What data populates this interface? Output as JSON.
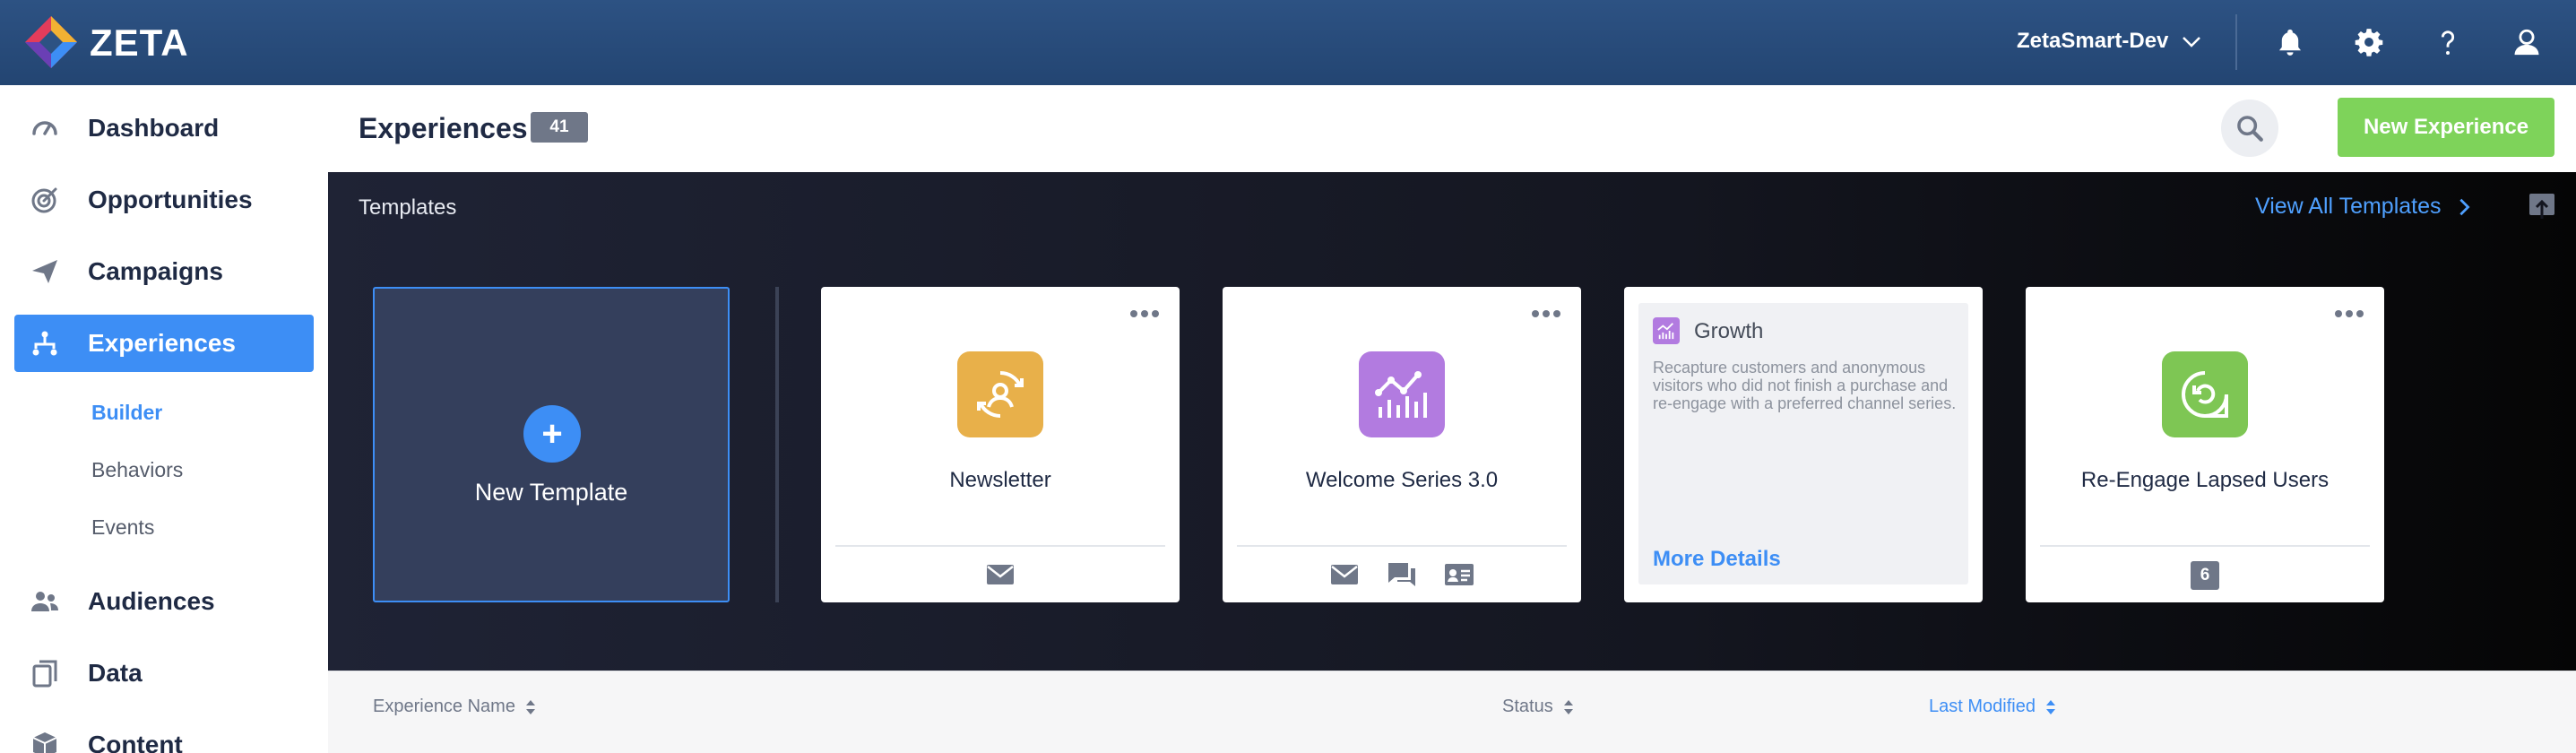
{
  "app": {
    "brand": "ZETA"
  },
  "topbar": {
    "account_name": "ZetaSmart-Dev",
    "icons": [
      "bell-icon",
      "gear-icon",
      "help-icon",
      "user-icon"
    ]
  },
  "sidebar": {
    "items": [
      {
        "label": "Dashboard",
        "icon": "gauge-icon"
      },
      {
        "label": "Opportunities",
        "icon": "target-icon"
      },
      {
        "label": "Campaigns",
        "icon": "paper-plane-icon"
      },
      {
        "label": "Experiences",
        "icon": "flow-icon",
        "active": true
      },
      {
        "label": "Audiences",
        "icon": "people-icon"
      },
      {
        "label": "Data",
        "icon": "files-icon"
      },
      {
        "label": "Content",
        "icon": "box-icon"
      }
    ],
    "subitems": [
      {
        "label": "Builder",
        "active": true
      },
      {
        "label": "Behaviors"
      },
      {
        "label": "Events"
      }
    ]
  },
  "header": {
    "title": "Experiences",
    "count": "41",
    "new_button": "New Experience"
  },
  "templates": {
    "title": "Templates",
    "view_all": "View All Templates",
    "new_template": "New Template",
    "cards": [
      {
        "name": "Newsletter",
        "icon_color": "#e8b04a",
        "channels": [
          "email-icon"
        ]
      },
      {
        "name": "Welcome Series 3.0",
        "icon_color": "#b27be0",
        "channels": [
          "email-icon",
          "chat-icon",
          "id-card-icon"
        ]
      },
      {
        "name": "Growth",
        "description": "Recapture customers and anonymous visitors who did not finish a purchase and re-engage with a preferred channel series.",
        "link": "More Details"
      },
      {
        "name": "Re-Engage Lapsed Users",
        "icon_color": "#7ec654",
        "badge": "6"
      }
    ]
  },
  "table": {
    "columns": [
      {
        "label": "Experience Name"
      },
      {
        "label": "Status"
      },
      {
        "label": "Last Modified",
        "active": true
      }
    ]
  },
  "colors": {
    "accent": "#3d8ef5",
    "success": "#7ed35a",
    "topbar": "#2d5283"
  }
}
